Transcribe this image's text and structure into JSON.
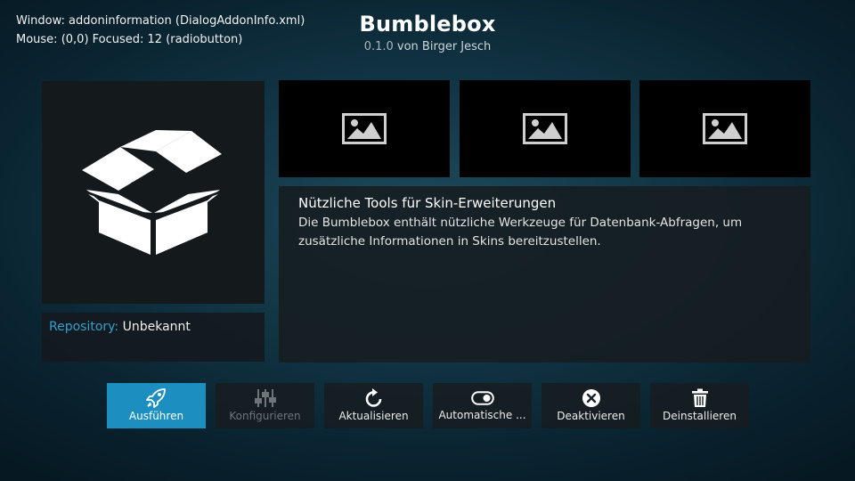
{
  "debug": {
    "window_line": "Window: addoninformation (DialogAddonInfo.xml)",
    "mouse_line": "Mouse: (0,0)  Focused: 12 (radiobutton)"
  },
  "addon": {
    "name": "Bumblebox",
    "version": "0.1.0",
    "author_text": "von Birger Jesch",
    "icon": "open-box-icon"
  },
  "repository": {
    "label": "Repository:",
    "value": "Unbekannt"
  },
  "screenshots": [
    {
      "icon": "image-placeholder-icon"
    },
    {
      "icon": "image-placeholder-icon"
    },
    {
      "icon": "image-placeholder-icon"
    }
  ],
  "description": {
    "title": "Nützliche Tools für Skin-Erweiterungen",
    "body": "Die Bumblebox enthält nützliche Werkzeuge für Datenbank-Abfragen, um zusätzliche Informationen in Skins bereitzustellen."
  },
  "buttons": [
    {
      "label": "Ausführen",
      "icon": "rocket-icon",
      "state": "focused"
    },
    {
      "label": "Konfigurieren",
      "icon": "sliders-icon",
      "state": "disabled"
    },
    {
      "label": "Aktualisieren",
      "icon": "refresh-icon",
      "state": "normal"
    },
    {
      "label": "Automatische ...",
      "icon": "toggle-icon",
      "state": "normal"
    },
    {
      "label": "Deaktivieren",
      "icon": "close-circle-icon",
      "state": "normal"
    },
    {
      "label": "Deinstallieren",
      "icon": "trash-icon",
      "state": "normal"
    }
  ],
  "colors": {
    "accent": "#1c8fc0",
    "repo_label": "#2ea0d0"
  }
}
